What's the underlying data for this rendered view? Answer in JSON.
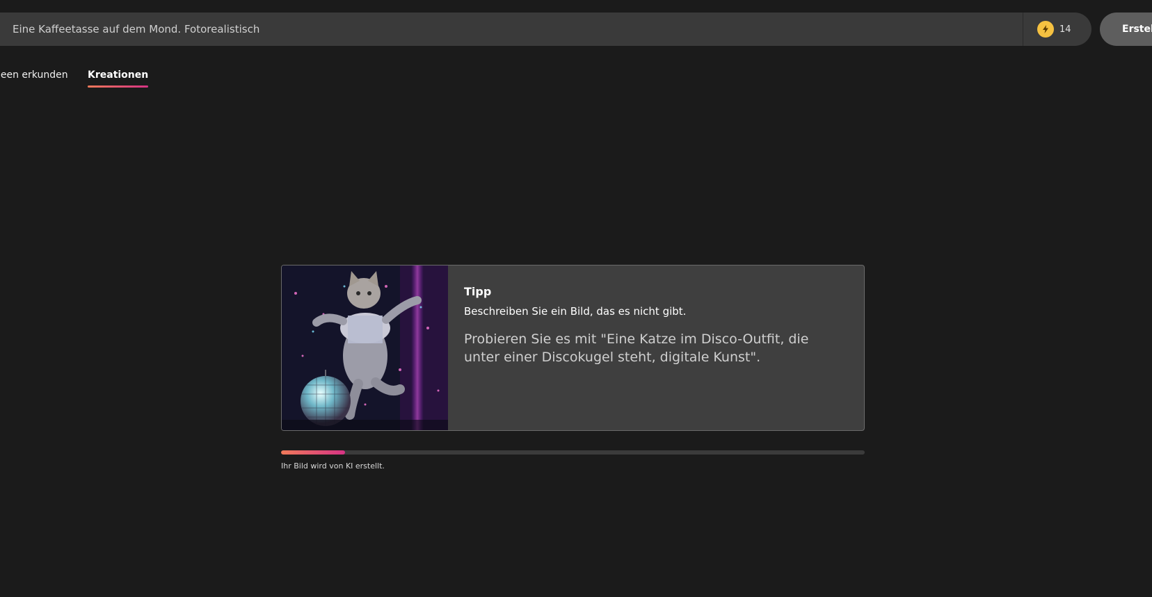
{
  "search": {
    "value": "Eine Kaffeetasse auf dem Mond. Fotorealistisch",
    "boost_icon": "lightning-bolt-icon",
    "boost_count": "14",
    "create_label": "Erstel"
  },
  "tabs": [
    {
      "label": "deen erkunden",
      "active": false
    },
    {
      "label": "Kreationen",
      "active": true
    }
  ],
  "tip": {
    "title": "Tipp",
    "text": "Beschreiben Sie ein Bild, das es nicht gibt.",
    "suggestion": "Probieren Sie es mit \"Eine Katze im Disco-Outfit, die unter einer Discokugel steht, digitale Kunst\".",
    "image": "disco-cat-illustration"
  },
  "progress": {
    "value": 0.11,
    "label": "Ihr Bild wird von KI erstellt."
  },
  "colors": {
    "background": "#1b1b1b",
    "accent_start": "#f07a5a",
    "accent_end": "#d63384",
    "boost": "#f5c141"
  }
}
